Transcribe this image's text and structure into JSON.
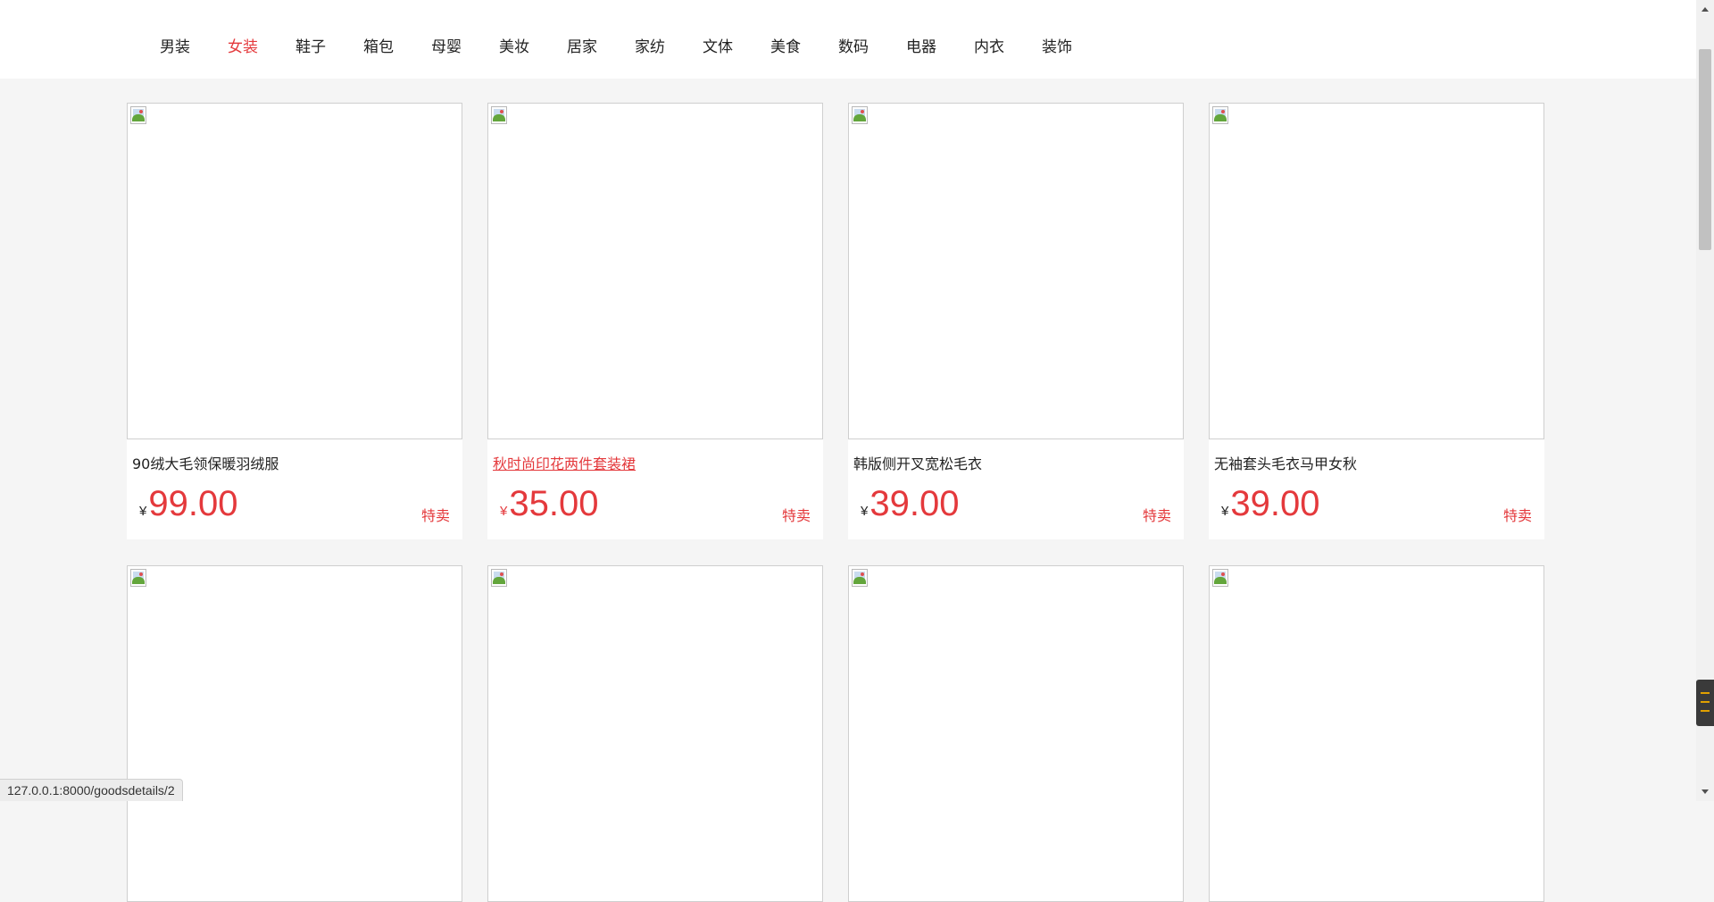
{
  "nav": {
    "items": [
      "男装",
      "女装",
      "鞋子",
      "箱包",
      "母婴",
      "美妆",
      "居家",
      "家纺",
      "文体",
      "美食",
      "数码",
      "电器",
      "内衣",
      "装饰"
    ],
    "active_index": 1
  },
  "products": [
    {
      "title": "90绒大毛领保暖羽绒服",
      "currency": "¥",
      "price": "99.00",
      "tag": "特卖"
    },
    {
      "title": "秋时尚印花两件套装裙",
      "currency": "¥",
      "price": "35.00",
      "tag": "特卖"
    },
    {
      "title": "韩版侧开叉宽松毛衣",
      "currency": "¥",
      "price": "39.00",
      "tag": "特卖"
    },
    {
      "title": "无袖套头毛衣马甲女秋",
      "currency": "¥",
      "price": "39.00",
      "tag": "特卖"
    }
  ],
  "status_url": "127.0.0.1:8000/goodsdetails/2",
  "colors": {
    "accent": "#e4393c",
    "background": "#f5f5f5"
  }
}
